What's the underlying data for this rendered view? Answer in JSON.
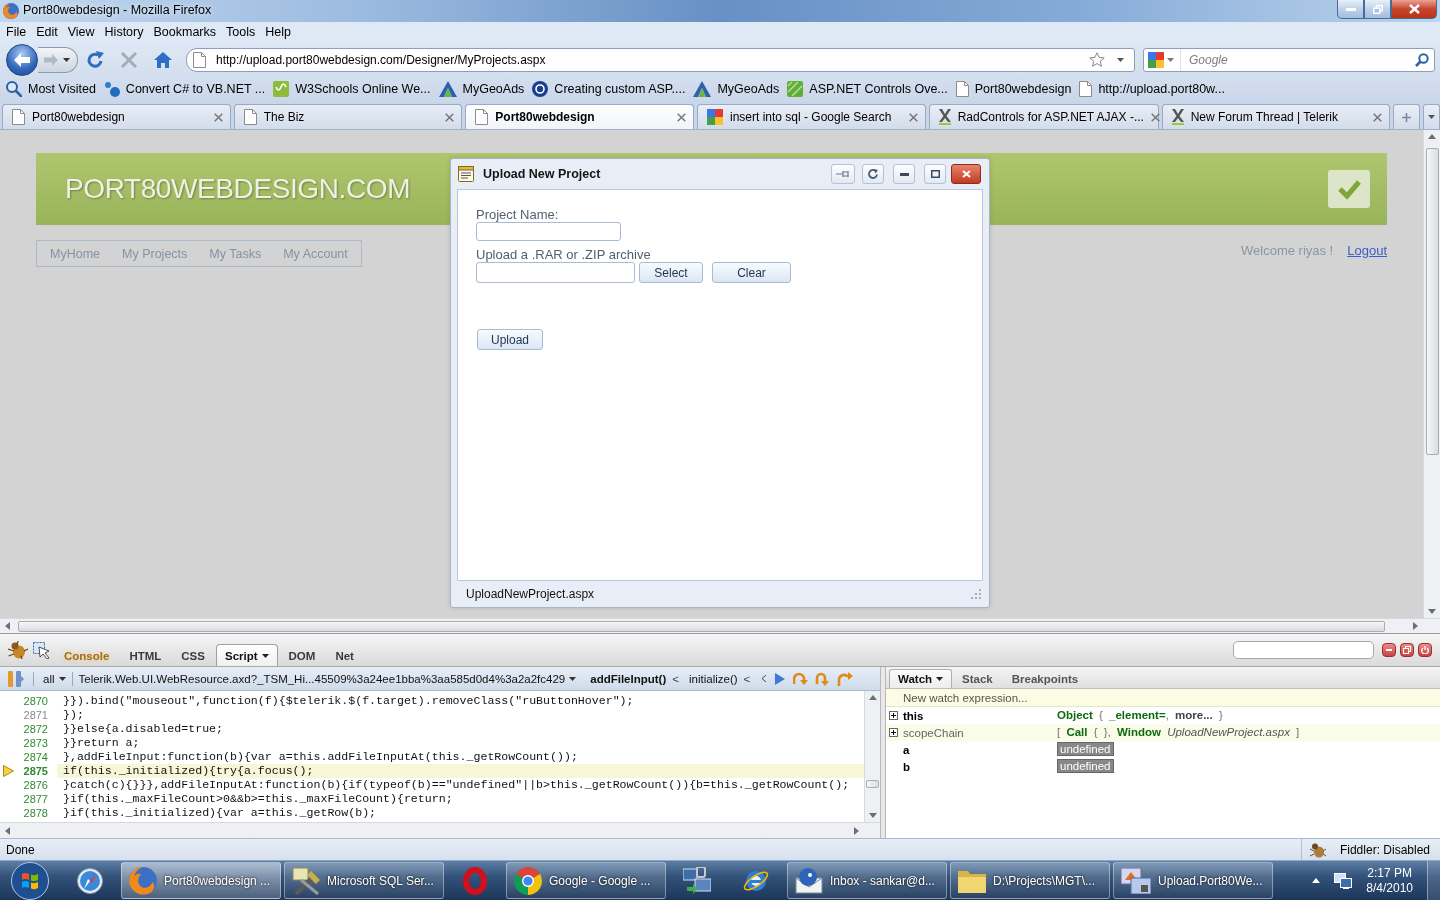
{
  "window": {
    "title": "Port80webdesign - Mozilla Firefox"
  },
  "menu": [
    "File",
    "Edit",
    "View",
    "History",
    "Bookmarks",
    "Tools",
    "Help"
  ],
  "nav_buttons": [
    {
      "kind": "back",
      "disabled": false
    },
    {
      "kind": "forward",
      "disabled": true
    },
    {
      "kind": "reload",
      "disabled": false
    },
    {
      "kind": "stop",
      "disabled": true
    },
    {
      "kind": "home",
      "disabled": false
    }
  ],
  "address": {
    "url": "http://upload.port80webdesign.com/Designer/MyProjects.aspx"
  },
  "search": {
    "placeholder": "Google"
  },
  "bookmarks": [
    {
      "kind": "search",
      "label": "Most Visited"
    },
    {
      "kind": "dots",
      "label": "Convert C# to VB.NET ..."
    },
    {
      "kind": "tile",
      "label": "W3Schools Online We..."
    },
    {
      "kind": "arrow",
      "label": "MyGeoAds"
    },
    {
      "kind": "disc",
      "label": "Creating custom ASP...."
    },
    {
      "kind": "arrow",
      "label": "MyGeoAds"
    },
    {
      "kind": "stripes",
      "label": "ASP.NET Controls Ove..."
    },
    {
      "kind": "page",
      "label": "Port80webdesign"
    },
    {
      "kind": "page",
      "label": "http://upload.port80w..."
    }
  ],
  "tabs": [
    {
      "kind": "page",
      "label": "Port80webdesign",
      "selected": false
    },
    {
      "kind": "page",
      "label": "The Biz",
      "selected": false
    },
    {
      "kind": "page",
      "label": "Port80webdesign",
      "selected": true
    },
    {
      "kind": "google",
      "label": "insert into sql - Google Search",
      "selected": false
    },
    {
      "kind": "telerik",
      "label": "RadControls for ASP.NET AJAX -...",
      "selected": false
    },
    {
      "kind": "telerik",
      "label": "New Forum Thread | Telerik",
      "selected": false
    }
  ],
  "page": {
    "site_title": "PORT80WEBDESIGN.COM",
    "nav": [
      "MyHome",
      "My Projects",
      "My Tasks",
      "My Account"
    ],
    "welcome": "Welcome riyas !",
    "logout": "Logout"
  },
  "dialog": {
    "title": "Upload New Project",
    "project_name_label": "Project Name:",
    "archive_label": "Upload a .RAR or .ZIP archive",
    "buttons": {
      "select": "Select",
      "clear": "Clear",
      "upload": "Upload"
    },
    "status": "UploadNewProject.aspx"
  },
  "firebug": {
    "tabs": [
      {
        "label": "Console",
        "selected": false,
        "highlighted": true,
        "menu": false
      },
      {
        "label": "HTML",
        "selected": false,
        "highlighted": false,
        "menu": false
      },
      {
        "label": "CSS",
        "selected": false,
        "highlighted": false,
        "menu": false
      },
      {
        "label": "Script",
        "selected": true,
        "highlighted": false,
        "menu": true
      },
      {
        "label": "DOM",
        "selected": false,
        "highlighted": false,
        "menu": false
      },
      {
        "label": "Net",
        "selected": false,
        "highlighted": false,
        "menu": false
      }
    ],
    "script_toolbar": {
      "filter": "all",
      "file": "Telerik.Web.UI.WebResource.axd?_TSM_Hi...45509%3a24ee1bba%3aa585d0d4%3a2a2fc429",
      "separator": "<",
      "frames": [
        {
          "label": "addFileInput()",
          "selected": true
        },
        {
          "label": "initialize()",
          "selected": false
        }
      ]
    },
    "code": {
      "lines": [
        {
          "number": "2870",
          "text": "}}).bind(\"mouseout\",function(f){$telerik.$(f.target).removeClass(\"ruButtonHover\");",
          "executable": true,
          "current": false
        },
        {
          "number": "2871",
          "text": "});",
          "executable": false,
          "current": false
        },
        {
          "number": "2872",
          "text": "}}else{a.disabled=true;",
          "executable": true,
          "current": false
        },
        {
          "number": "2873",
          "text": "}}return a;",
          "executable": true,
          "current": false
        },
        {
          "number": "2874",
          "text": "},addFileInput:function(b){var a=this.addFileInputAt(this._getRowCount());",
          "executable": true,
          "current": false
        },
        {
          "number": "2875",
          "text": "if(this._initialized){try{a.focus();",
          "executable": true,
          "current": true
        },
        {
          "number": "2876",
          "text": "}catch(c){}}},addFileInputAt:function(b){if(typeof(b)==\"undefined\"||b>this._getRowCount()){b=this._getRowCount();",
          "executable": true,
          "current": false
        },
        {
          "number": "2877",
          "text": "}if(this._maxFileCount>0&&b>=this._maxFileCount){return;",
          "executable": true,
          "current": false
        },
        {
          "number": "2878",
          "text": "}if(this._initialized){var a=this._getRow(b);",
          "executable": true,
          "current": false
        }
      ]
    },
    "watch": {
      "tabs": [
        {
          "label": "Watch",
          "selected": true,
          "menu": true
        },
        {
          "label": "Stack",
          "selected": false,
          "menu": false
        },
        {
          "label": "Breakpoints",
          "selected": false,
          "menu": false
        }
      ],
      "placeholder": "New watch expression...",
      "rows": [
        {
          "name": "this",
          "kind": "variable",
          "expandable": true,
          "value": [
            {
              "kind": "class",
              "text": "Object"
            },
            {
              "kind": "punct",
              "text": "{"
            },
            {
              "kind": "prop",
              "text": "_element="
            },
            {
              "kind": "punct",
              "text": ",",
              "attached": true
            },
            {
              "kind": "more",
              "text": "more..."
            },
            {
              "kind": "punct",
              "text": "}"
            }
          ]
        },
        {
          "name": "scopeChain",
          "kind": "scope",
          "expandable": true,
          "value": [
            {
              "kind": "punct",
              "text": "["
            },
            {
              "kind": "class",
              "text": "Call"
            },
            {
              "kind": "punct",
              "text": "{"
            },
            {
              "kind": "punct",
              "text": "},"
            },
            {
              "kind": "class",
              "text": "Window"
            },
            {
              "kind": "location",
              "text": "UploadNewProject.aspx"
            },
            {
              "kind": "punct",
              "text": "]"
            }
          ]
        },
        {
          "name": "a",
          "kind": "variable",
          "expandable": false,
          "value": [
            {
              "kind": "undefined",
              "text": "undefined"
            }
          ]
        },
        {
          "name": "b",
          "kind": "variable",
          "expandable": false,
          "value": [
            {
              "kind": "undefined",
              "text": "undefined"
            }
          ]
        }
      ]
    }
  },
  "status_bar": {
    "text": "Done",
    "fiddler": "Fiddler: Disabled"
  },
  "taskbar": {
    "items": [
      {
        "kind": "start",
        "selected": false
      },
      {
        "kind": "compass",
        "selected": false
      },
      {
        "kind": "globe",
        "label": "Port80webdesign ...",
        "selected": true
      },
      {
        "kind": "tools",
        "label": "Microsoft SQL Ser...",
        "selected": false
      },
      {
        "kind": "ring",
        "selected": false
      },
      {
        "kind": "wheel",
        "label": "Google - Google ...",
        "selected": false
      },
      {
        "kind": "network",
        "selected": false
      },
      {
        "kind": "orbit",
        "selected": false
      },
      {
        "kind": "mail",
        "label": "Inbox - sankar@d...",
        "selected": false
      },
      {
        "kind": "folder",
        "label": "D:\\Projects\\MGT\\...",
        "selected": false
      },
      {
        "kind": "studio",
        "label": "Upload.Port80We...",
        "selected": false
      }
    ],
    "clock": {
      "time": "2:17 PM",
      "date": "8/4/2010"
    }
  }
}
